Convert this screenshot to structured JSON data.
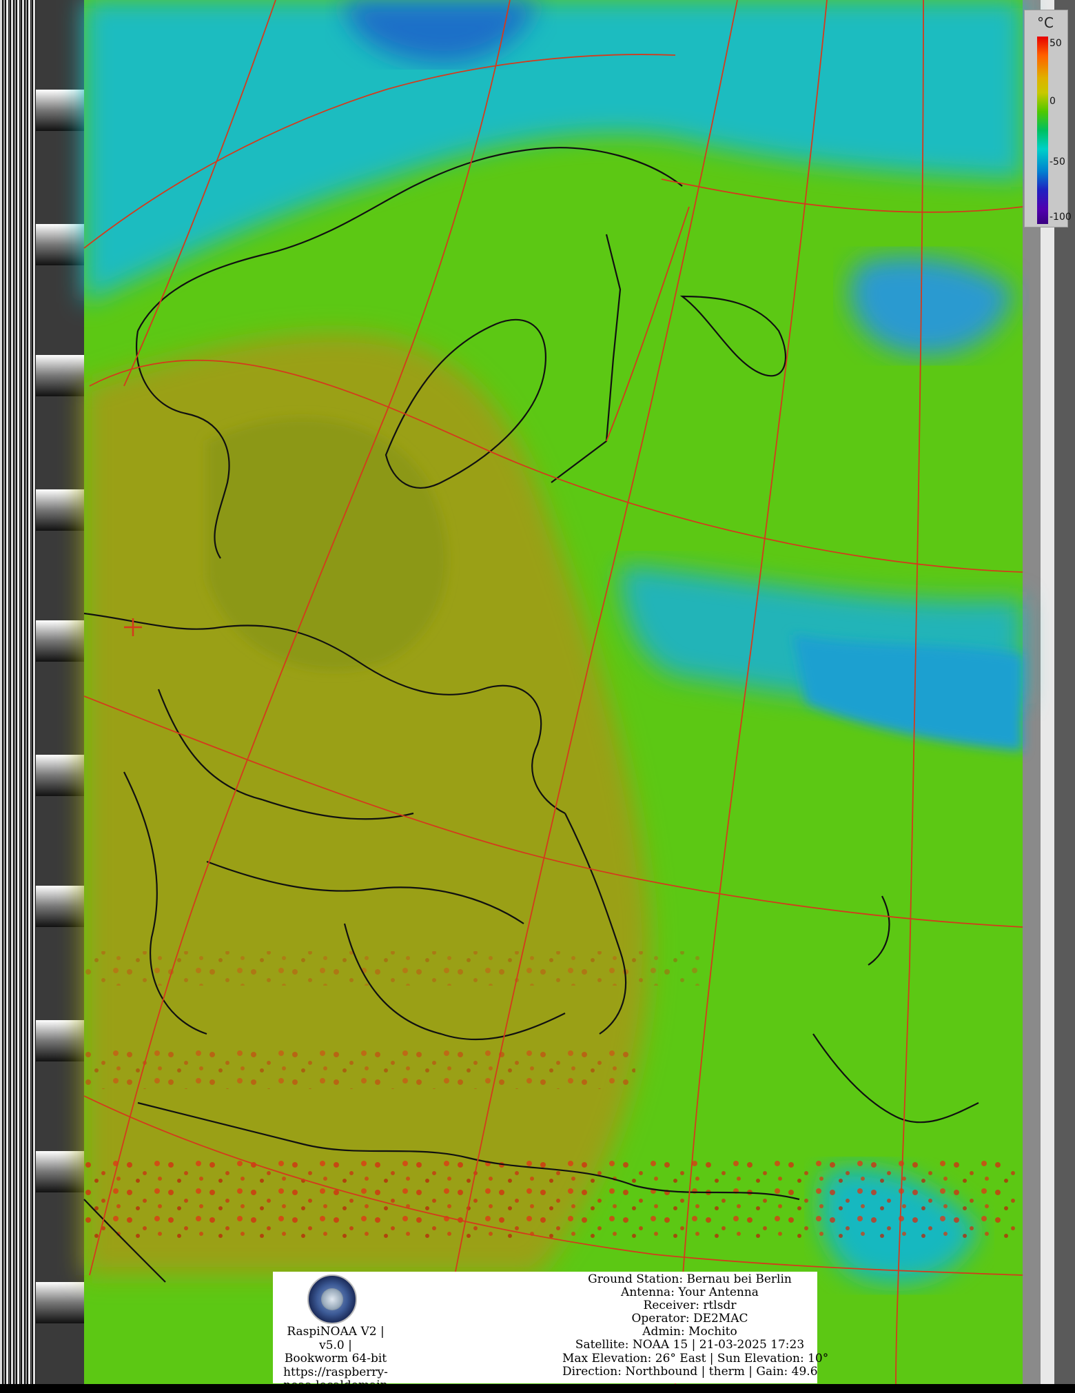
{
  "legend": {
    "unit": "°C",
    "ticks": [
      "50",
      "0",
      "-50",
      "-100"
    ]
  },
  "info_panel": {
    "left_lines": [
      "RaspiNOAA V2 | v5.0 |",
      "Bookworm 64-bit",
      "https://raspberry-",
      "noaa.localdomain"
    ],
    "right_lines": [
      "Ground Station: Bernau bei Berlin",
      "Antenna: Your Antenna",
      "Receiver: rtlsdr",
      "Operator: DE2MAC",
      "Admin: Mochito",
      "Satellite: NOAA 15 | 21-03-2025 17:23",
      "Max Elevation: 26° East | Sun Elevation: 10°",
      "Direction: Northbound | therm | Gain: 49.6"
    ]
  },
  "colors": {
    "graticule": "#d43a1c",
    "borders": "#101010",
    "cold_cloud": "#19c8c8",
    "mild_land": "#6aa000",
    "warm_land": "#a0a018",
    "hot_spots": "#d02a10",
    "sea_green": "#52cc10"
  }
}
